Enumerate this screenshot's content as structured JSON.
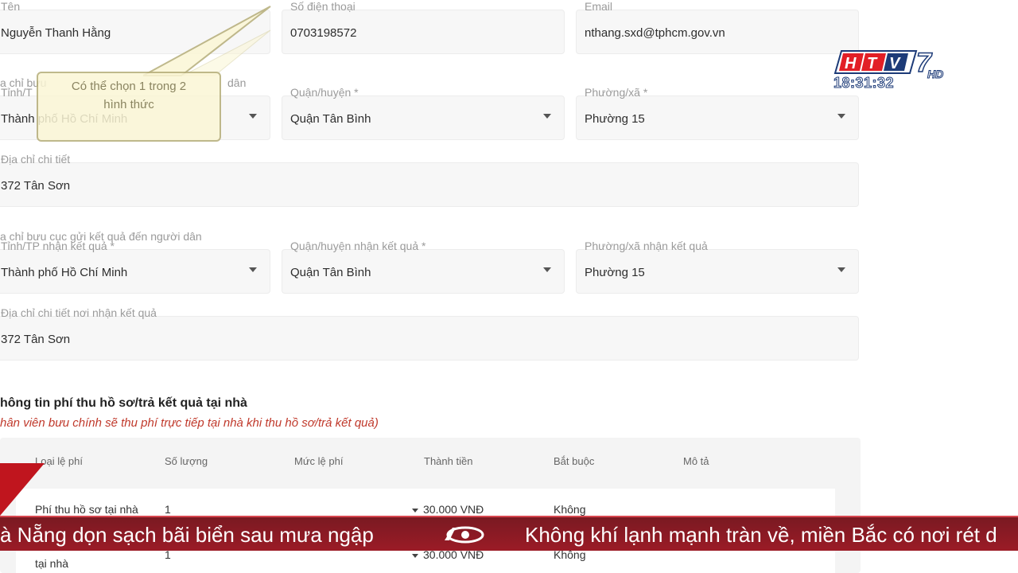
{
  "contact": {
    "name_label": "Tên",
    "name_value": "Nguyễn Thanh Hằng",
    "phone_label": "Số điện thoại",
    "phone_value": "0703198572",
    "email_label": "Email",
    "email_value": "nthang.sxd@tphcm.gov.vn"
  },
  "address": {
    "section_label": "a chỉ bưu",
    "section_label_tail": "dân",
    "province_label": "Tỉnh/T",
    "province_value": "Thành phố Hồ Chí Minh",
    "district_label": "Quận/huyện *",
    "district_value": "Quận Tân Bình",
    "ward_label": "Phường/xã *",
    "ward_value": "Phường 15",
    "detail_label": "Địa chỉ chi tiết",
    "detail_value": "372 Tân Sơn"
  },
  "callout": {
    "text_line1": "Có thể chọn 1 trong 2",
    "text_line2": "hình thức"
  },
  "result_address": {
    "section_label": "a chỉ bưu cục gửi kết quả đến người dân",
    "province_label": "Tỉnh/TP nhận kết quả *",
    "province_value": "Thành phố Hồ Chí Minh",
    "district_label": "Quận/huyện nhận kết quả *",
    "district_value": "Quận Tân Bình",
    "ward_label": "Phường/xã nhận kết quả",
    "ward_value": "Phường 15",
    "detail_label": "Địa chỉ chi tiết nơi nhận kết quả",
    "detail_value": "372 Tân Sơn"
  },
  "fees": {
    "title": "hông tin phí thu hồ sơ/trả kết quả tại nhà",
    "note": "hân viên bưu chính sẽ thu phí trực tiếp tại nhà khi thu hồ sơ/trả kết quả)",
    "columns": [
      "Loại lệ phí",
      "Số lượng",
      "Mức lệ phí",
      "Thành tiền",
      "Bắt buộc",
      "Mô tả"
    ],
    "rows": [
      {
        "type": "Phí thu hồ sơ tại nhà",
        "qty": "1",
        "amount": "30.000 VNĐ",
        "required": "Không"
      },
      {
        "type": "tại nhà",
        "qty": "1",
        "amount": "30.000 VNĐ",
        "required": "Không"
      }
    ]
  },
  "broadcast": {
    "channel": "HTV7",
    "hd": "HD",
    "time": "18:31:32",
    "ticker_left": "à Nẵng dọn sạch bãi biển sau mưa ngập",
    "ticker_right": "Không khí lạnh mạnh tràn về, miền Bắc có nơi rét d",
    "accent_color": "#9b1b26"
  }
}
